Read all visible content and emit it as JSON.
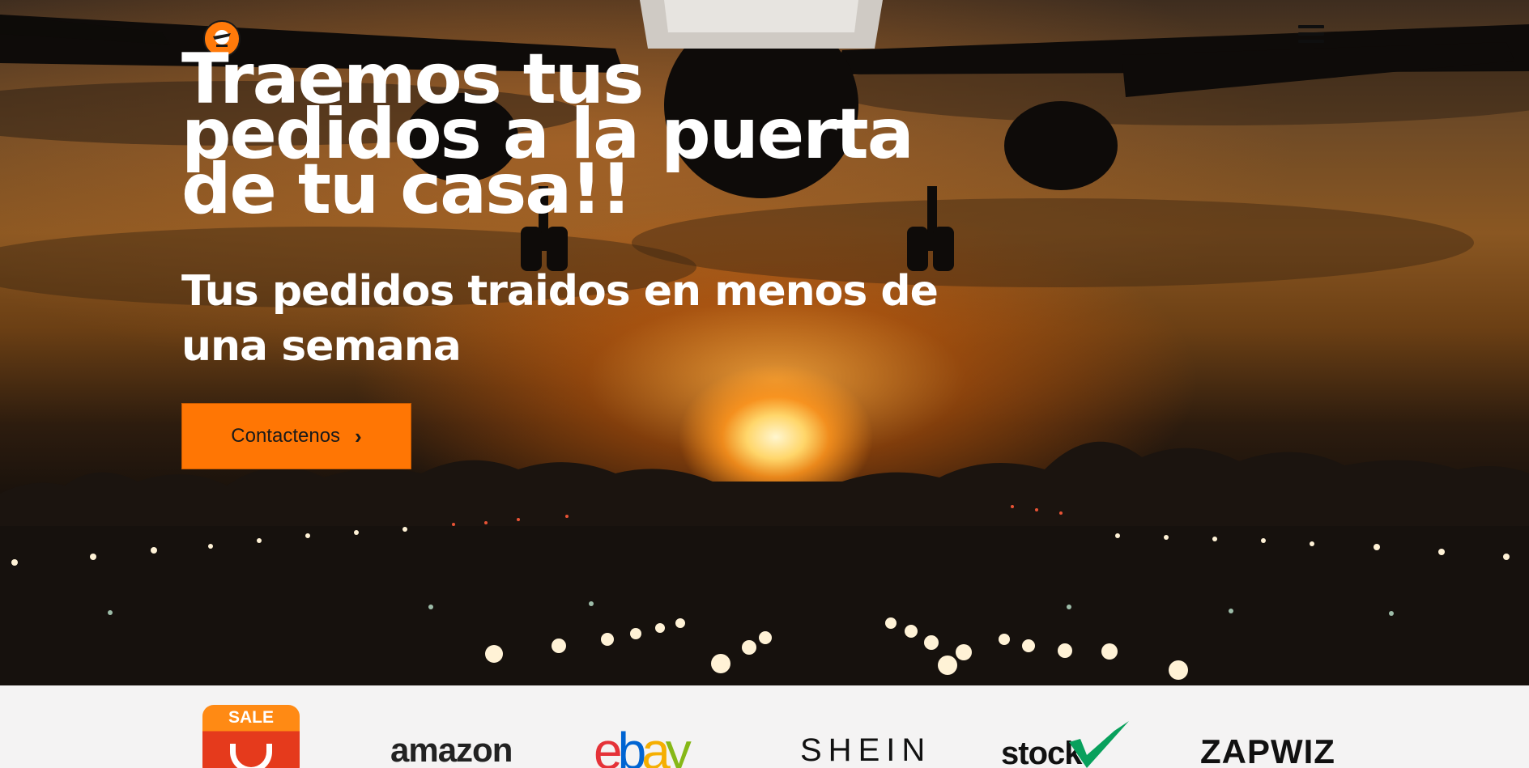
{
  "header": {
    "logo_icon": "delivery-logo-icon",
    "menu_icon": "hamburger-menu-icon"
  },
  "hero": {
    "headline": "Traemos tus pedidos a la puerta de tu casa!!",
    "subheadline": "Tus pedidos traidos en menos de una semana",
    "cta_label": "Contactenos",
    "cta_icon": "chevron-right-icon",
    "background": "airplane-landing-sunset-image"
  },
  "brands": {
    "items": [
      {
        "name": "AliExpress",
        "badge": "SALE"
      },
      {
        "name": "amazon"
      },
      {
        "name": "ebay"
      },
      {
        "name": "SHEIN"
      },
      {
        "name": "stock"
      },
      {
        "name": "ZAPWIZ"
      }
    ]
  },
  "colors": {
    "accent": "#ff7604",
    "brand_strip_bg": "#f4f3f3"
  }
}
